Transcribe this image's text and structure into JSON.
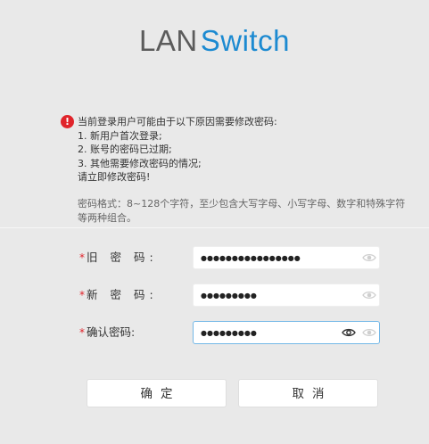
{
  "logo": {
    "part1": "LAN",
    "part2": "Switch"
  },
  "notice": {
    "lines": [
      "当前登录用户可能由于以下原因需要修改密码:",
      "1. 新用户首次登录;",
      "2. 账号的密码已过期;",
      "3. 其他需要修改密码的情况;",
      "请立即修改密码!"
    ],
    "format_lines": [
      "密码格式：8~128个字符，至少包含大写字母、小写字母、数字和特殊字符",
      "等两种组合。"
    ]
  },
  "form": {
    "required_mark": "*",
    "old_password": {
      "label": "旧 密 码:",
      "value": "●●●●●●●●●●●●●●●●"
    },
    "new_password": {
      "label": "新 密 码:",
      "value": "●●●●●●●●●"
    },
    "confirm_password": {
      "label": "确认密码:",
      "value": "●●●●●●●●●"
    }
  },
  "buttons": {
    "confirm": "确定",
    "cancel": "取消"
  },
  "colors": {
    "brand_blue": "#1c8ad1",
    "error_red": "#e0242b",
    "focus_border": "#74b8e7"
  },
  "icons": {
    "warning": "exclamation-circle",
    "show_password": "eye",
    "hide_password": "eye-outline"
  }
}
